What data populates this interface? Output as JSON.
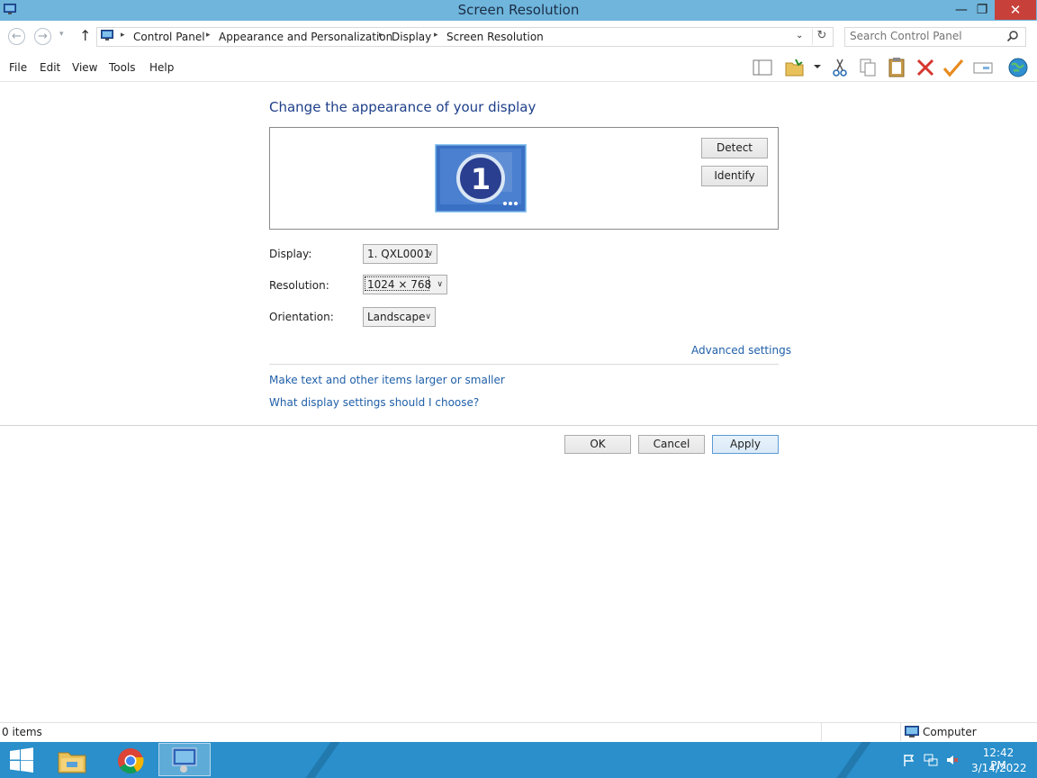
{
  "window": {
    "title": "Screen Resolution",
    "minimize_glyph": "—",
    "maximize_glyph": "❐",
    "close_glyph": "✕"
  },
  "address": {
    "crumbs": [
      "Control Panel",
      "Appearance and Personalization",
      "Display",
      "Screen Resolution"
    ],
    "separator": "▸",
    "dropdown_glyph": "⌄",
    "refresh_glyph": "↻"
  },
  "nav": {
    "back": "←",
    "forward": "→",
    "recent": "▾",
    "up": "↑"
  },
  "search": {
    "placeholder": "Search Control Panel",
    "value": ""
  },
  "menu": [
    "File",
    "Edit",
    "View",
    "Tools",
    "Help"
  ],
  "toolbar_icons": [
    "preview-pane-icon",
    "folder-properties-icon",
    "cut-icon",
    "copy-icon",
    "paste-icon",
    "delete-icon",
    "checkmark-icon",
    "rename-icon",
    "globe-icon"
  ],
  "content": {
    "heading": "Change the appearance of your display",
    "monitor_number": "1",
    "detect_label": "Detect",
    "identify_label": "Identify",
    "display_label": "Display:",
    "display_value": "1. QXL0001",
    "resolution_label": "Resolution:",
    "resolution_value": "1024 × 768",
    "orientation_label": "Orientation:",
    "orientation_value": "Landscape",
    "advanced_link": "Advanced settings",
    "text_size_link": "Make text and other items larger or smaller",
    "which_settings_link": "What display settings should I choose?",
    "ok_label": "OK",
    "cancel_label": "Cancel",
    "apply_label": "Apply",
    "select_chevron": "∨"
  },
  "status": {
    "items": "0 items",
    "location": "Computer"
  },
  "taskbar": {
    "time": "12:42 PM",
    "date": "3/14/2022"
  },
  "colors": {
    "titlebar": "#6fb5dc",
    "close": "#c7413a",
    "link": "#1f5fa8",
    "heading": "#1e3f8a",
    "taskbar": "#2a8fcb"
  }
}
